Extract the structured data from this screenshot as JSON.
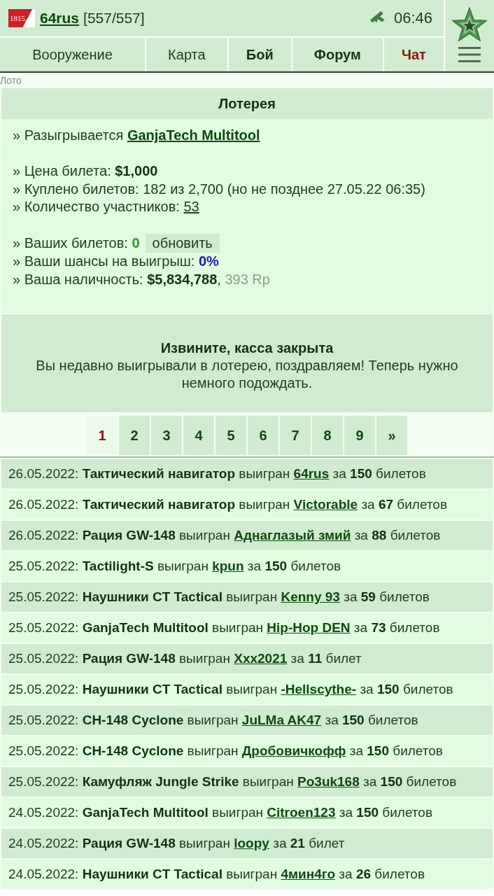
{
  "header": {
    "logo_text": "1815",
    "username": "64rus",
    "rank": "[557/557]",
    "time": "06:46"
  },
  "nav_tabs": [
    {
      "label": "Вооружение",
      "kind": "plain"
    },
    {
      "label": "Карта",
      "kind": "plain"
    },
    {
      "label": "Бой",
      "kind": "bold"
    },
    {
      "label": "Форум",
      "kind": "bold"
    },
    {
      "label": "Чат",
      "kind": "alert"
    }
  ],
  "breadcrumb": "Лото",
  "lottery": {
    "title": "Лотерея",
    "groups": [
      [
        {
          "kind": "link",
          "text": "» Разыгрывается",
          "link": "GanjaTech Multitool",
          "bold": true
        }
      ],
      [
        {
          "kind": "text",
          "text": "» Цена билета: **$1,000**"
        },
        {
          "kind": "text",
          "text": "» Куплено билетов: 182 из 2,700 (но не позднее 27.05.22 06:35)"
        },
        {
          "kind": "link",
          "text": "» Количество участников:",
          "link": "53",
          "bold": false
        }
      ],
      [
        {
          "kind": "tickets",
          "text": "» Ваших билетов:",
          "value": "0",
          "button": "обновить"
        },
        {
          "kind": "chance",
          "text": "» Ваши шансы на выигрыш:",
          "value": "0%"
        },
        {
          "kind": "cash",
          "text": "» Ваша наличность: **$5,834,788**,",
          "extra": "393 Rp"
        }
      ]
    ]
  },
  "notice": {
    "title": "Извините, касса закрыта",
    "message": "Вы недавно выигрывали в лотерею, поздравляем! Теперь нужно немного подождать."
  },
  "pagination": {
    "pages": [
      {
        "label": "1",
        "selected": true
      },
      {
        "label": "2",
        "selected": false
      },
      {
        "label": "3",
        "selected": false
      },
      {
        "label": "4",
        "selected": false
      },
      {
        "label": "5",
        "selected": false
      },
      {
        "label": "6",
        "selected": false
      },
      {
        "label": "7",
        "selected": false
      },
      {
        "label": "8",
        "selected": false
      },
      {
        "label": "9",
        "selected": false
      }
    ],
    "next": "»"
  },
  "history": [
    {
      "head": "26.05.2022: **Тактический навигатор** выигран",
      "winner": "64rus",
      "tail": "за **150** билетов"
    },
    {
      "head": "26.05.2022: **Тактический навигатор** выигран",
      "winner": "Victorable",
      "tail": "за **67** билетов"
    },
    {
      "head": "26.05.2022: **Рация GW-148** выигран",
      "winner": "Аднаглазый змий",
      "tail": "за **88** билетов"
    },
    {
      "head": "25.05.2022: **Tactilight-S** выигран",
      "winner": "kpun",
      "tail": "за **150** билетов"
    },
    {
      "head": "25.05.2022: **Наушники CT Tactical** выигран",
      "winner": "Kenny 93",
      "tail": "за **59** билетов"
    },
    {
      "head": "25.05.2022: **GanjaTech Multitool** выигран",
      "winner": "Hip-Hop DEN",
      "tail": "за **73** билетов"
    },
    {
      "head": "25.05.2022: **Рация GW-148** выигран",
      "winner": "Xxx2021",
      "tail": "за **11** билет"
    },
    {
      "head": "25.05.2022: **Наушники CT Tactical** выигран",
      "winner": "-Hellscythe-",
      "tail": "за **150** билетов"
    },
    {
      "head": "25.05.2022: **CH-148 Cyclone** выигран",
      "winner": "JuLMa AK47",
      "tail": "за **150** билетов"
    },
    {
      "head": "25.05.2022: **CH-148 Cyclone** выигран",
      "winner": "Дробовичкофф",
      "tail": "за **150** билетов"
    },
    {
      "head": "25.05.2022: **Камуфляж Jungle Strike** выигран",
      "winner": "Po3uk168",
      "tail": "за **150** билетов"
    },
    {
      "head": "24.05.2022: **GanjaTech Multitool** выигран",
      "winner": "Citroen123",
      "tail": "за **150** билетов"
    },
    {
      "head": "24.05.2022: **Рация GW-148** выигран",
      "winner": "loopy",
      "tail": "за **21** билет"
    },
    {
      "head": "24.05.2022: **Наушники CT Tactical** выигран",
      "winner": "4мин4го",
      "tail": "за **26** билетов"
    }
  ]
}
